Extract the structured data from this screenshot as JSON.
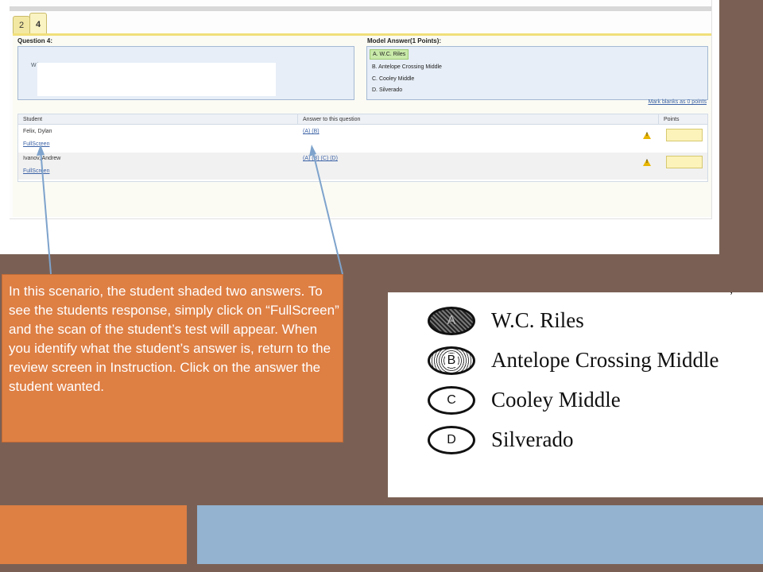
{
  "screenshot": {
    "tabs": [
      "2",
      "4"
    ],
    "question_heading": "Question 4:",
    "question_text": "Wh...",
    "model_answer_heading": "Model Answer(1 Points):",
    "model_options": [
      "A.  W.C. Riles",
      "B.  Antelope Crossing Middle",
      "C.  Cooley Middle",
      "D.  Silverado"
    ],
    "mark_blanks_link": "Mark blanks as 0 points",
    "table": {
      "headers": [
        "Student",
        "Answer to this question",
        "Points"
      ],
      "rows": [
        {
          "student": "Felix, Dylan",
          "fullscreen": "FullScreen",
          "answer": "(A) (B)"
        },
        {
          "student": "Ivanov, Andrew",
          "fullscreen": "FullScreen",
          "answer": "(A) (B) (C) (D)"
        }
      ]
    }
  },
  "callout": {
    "text": "In this scenario, the student shaded two answers. To see the students response, simply click on “FullScreen” and the scan of the student’s test will appear. When you identify what the student’s answer is, return to the review screen in Instruction. Click on the answer the student wanted."
  },
  "scan": {
    "options": [
      {
        "letter": "A",
        "label": "W.C. Riles"
      },
      {
        "letter": "B",
        "label": "Antelope Crossing Middle"
      },
      {
        "letter": "C",
        "label": "Cooley Middle"
      },
      {
        "letter": "D",
        "label": "Silverado"
      }
    ]
  },
  "colors": {
    "background": "#7a6054",
    "accent_orange": "#de7f44",
    "accent_blue": "#93b3d0"
  },
  "icons": {
    "warning": "warning-icon"
  }
}
